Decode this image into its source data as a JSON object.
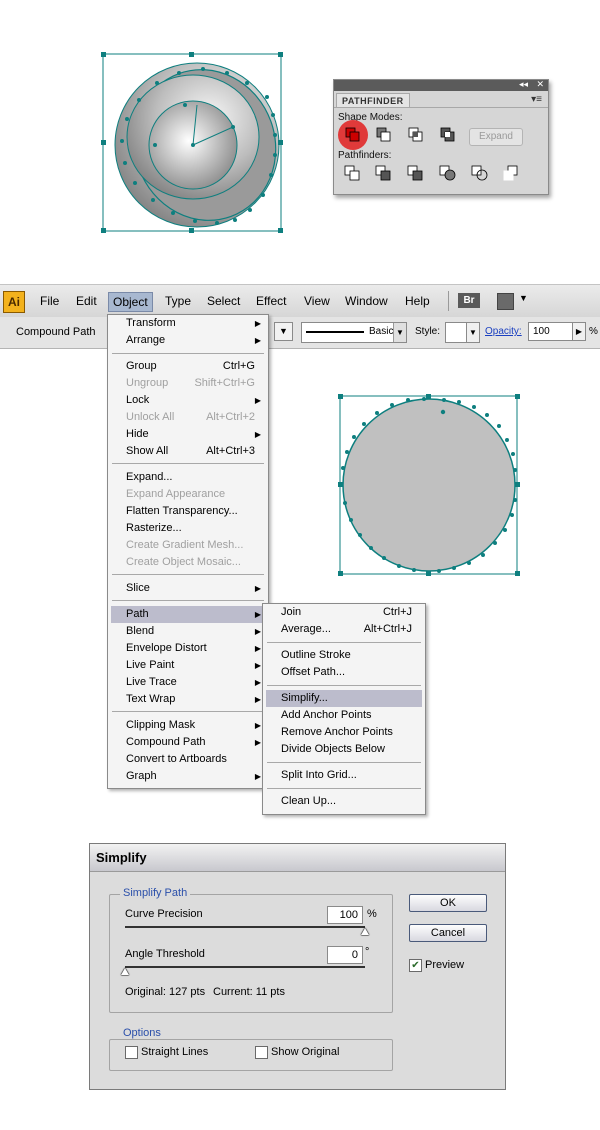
{
  "pathfinder_panel": {
    "title": "PATHFINDER",
    "collapse_glyph": "◂◂",
    "close_glyph": "✕",
    "menu_glyph": "▾≡",
    "shape_modes_label": "Shape Modes:",
    "pathfinders_label": "Pathfinders:",
    "expand_label": "Expand"
  },
  "menubar": {
    "logo": "Ai",
    "items": [
      "File",
      "Edit",
      "Object",
      "Type",
      "Select",
      "Effect",
      "View",
      "Window",
      "Help"
    ],
    "bridge_label": "Br"
  },
  "controlbar": {
    "selection_label": "Compound Path",
    "stroke_profile": "Basic",
    "style_label": "Style:",
    "opacity_label": "Opacity:",
    "opacity_value": "100",
    "percent": "%"
  },
  "object_menu": {
    "items": [
      {
        "label": "Transform",
        "shortcut": "",
        "submenu": true,
        "disabled": false
      },
      {
        "label": "Arrange",
        "shortcut": "",
        "submenu": true,
        "disabled": false
      },
      {
        "label": "Group",
        "shortcut": "Ctrl+G",
        "submenu": false,
        "disabled": false
      },
      {
        "label": "Ungroup",
        "shortcut": "Shift+Ctrl+G",
        "submenu": false,
        "disabled": true
      },
      {
        "label": "Lock",
        "shortcut": "",
        "submenu": true,
        "disabled": false
      },
      {
        "label": "Unlock All",
        "shortcut": "Alt+Ctrl+2",
        "submenu": false,
        "disabled": true
      },
      {
        "label": "Hide",
        "shortcut": "",
        "submenu": true,
        "disabled": false
      },
      {
        "label": "Show All",
        "shortcut": "Alt+Ctrl+3",
        "submenu": false,
        "disabled": false
      },
      {
        "label": "Expand...",
        "shortcut": "",
        "submenu": false,
        "disabled": false
      },
      {
        "label": "Expand Appearance",
        "shortcut": "",
        "submenu": false,
        "disabled": true
      },
      {
        "label": "Flatten Transparency...",
        "shortcut": "",
        "submenu": false,
        "disabled": false
      },
      {
        "label": "Rasterize...",
        "shortcut": "",
        "submenu": false,
        "disabled": false
      },
      {
        "label": "Create Gradient Mesh...",
        "shortcut": "",
        "submenu": false,
        "disabled": true
      },
      {
        "label": "Create Object Mosaic...",
        "shortcut": "",
        "submenu": false,
        "disabled": true
      },
      {
        "label": "Slice",
        "shortcut": "",
        "submenu": true,
        "disabled": false
      },
      {
        "label": "Path",
        "shortcut": "",
        "submenu": true,
        "disabled": false,
        "highlighted": true
      },
      {
        "label": "Blend",
        "shortcut": "",
        "submenu": true,
        "disabled": false
      },
      {
        "label": "Envelope Distort",
        "shortcut": "",
        "submenu": true,
        "disabled": false
      },
      {
        "label": "Live Paint",
        "shortcut": "",
        "submenu": true,
        "disabled": false
      },
      {
        "label": "Live Trace",
        "shortcut": "",
        "submenu": true,
        "disabled": false
      },
      {
        "label": "Text Wrap",
        "shortcut": "",
        "submenu": true,
        "disabled": false
      },
      {
        "label": "Clipping Mask",
        "shortcut": "",
        "submenu": true,
        "disabled": false
      },
      {
        "label": "Compound Path",
        "shortcut": "",
        "submenu": true,
        "disabled": false
      },
      {
        "label": "Convert to Artboards",
        "shortcut": "",
        "submenu": false,
        "disabled": false
      },
      {
        "label": "Graph",
        "shortcut": "",
        "submenu": true,
        "disabled": false
      }
    ]
  },
  "path_submenu": {
    "items": [
      {
        "label": "Join",
        "shortcut": "Ctrl+J"
      },
      {
        "label": "Average...",
        "shortcut": "Alt+Ctrl+J"
      },
      {
        "label": "Outline Stroke",
        "shortcut": ""
      },
      {
        "label": "Offset Path...",
        "shortcut": ""
      },
      {
        "label": "Simplify...",
        "shortcut": "",
        "highlighted": true
      },
      {
        "label": "Add Anchor Points",
        "shortcut": ""
      },
      {
        "label": "Remove Anchor Points",
        "shortcut": ""
      },
      {
        "label": "Divide Objects Below",
        "shortcut": ""
      },
      {
        "label": "Split Into Grid...",
        "shortcut": ""
      },
      {
        "label": "Clean Up...",
        "shortcut": ""
      }
    ]
  },
  "simplify_dialog": {
    "title": "Simplify",
    "group_label": "Simplify Path",
    "curve_precision_label": "Curve Precision",
    "curve_precision_value": "100",
    "curve_precision_unit": "%",
    "curve_precision_level": 1.0,
    "angle_threshold_label": "Angle Threshold",
    "angle_threshold_value": "0",
    "angle_threshold_unit": "°",
    "angle_threshold_level": 0.0,
    "original_text": "Original: 127 pts",
    "current_text": "Current: 11 pts",
    "options_label": "Options",
    "straight_lines_label": "Straight Lines",
    "straight_lines_checked": false,
    "show_original_label": "Show Original",
    "show_original_checked": false,
    "ok_label": "OK",
    "cancel_label": "Cancel",
    "preview_label": "Preview",
    "preview_checked": true
  },
  "colors": {
    "path_teal": "#0e7f7f",
    "highlight_red": "#e03a3a",
    "menu_highlight": "#bcbccc"
  }
}
